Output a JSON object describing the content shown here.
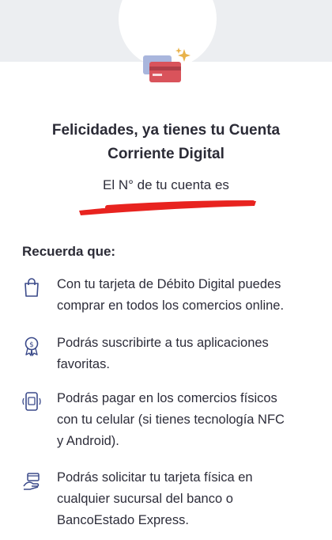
{
  "colors": {
    "background": "#ffffff",
    "top_band": "#eceef1",
    "card_front": "#d9535b",
    "card_back": "#a9b6dd",
    "sparkle": "#e8b24a",
    "text": "#2d2d3a",
    "icon_stroke": "#3b4a8a",
    "redaction": "#e8231f"
  },
  "hero": {
    "icon": "credit-cards-sparkle-icon"
  },
  "headline": {
    "line1": "Felicidades, ya tienes tu Cuenta",
    "line2": "Corriente Digital"
  },
  "account": {
    "label": "El N° de tu cuenta es",
    "number_redacted": true
  },
  "remember": {
    "title": "Recuerda que:",
    "items": [
      {
        "icon": "shopping-bag-icon",
        "line1": "Con tu tarjeta de Débito Digital puedes",
        "line2": "comprar en todos los comercios online."
      },
      {
        "icon": "award-badge-icon",
        "line1": "Podrás suscribirte a tus aplicaciones",
        "line2": "favoritas."
      },
      {
        "icon": "mobile-nfc-icon",
        "line1": "Podrás pagar en los comercios físicos",
        "line2": "con tu celular (si tienes tecnología NFC",
        "line3": "y Android)."
      },
      {
        "icon": "hand-card-icon",
        "line1": "Podrás solicitar tu tarjeta física en",
        "line2": "cualquier sucursal del banco o",
        "line3": "BancoEstado Express."
      }
    ]
  }
}
